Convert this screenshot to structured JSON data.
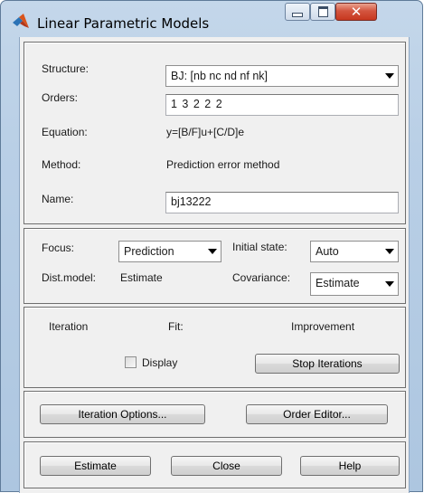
{
  "window": {
    "title": "Linear Parametric Models"
  },
  "model": {
    "structure_label": "Structure:",
    "structure_value": "BJ: [nb nc nd nf nk]",
    "orders_label": "Orders:",
    "orders_value": "1 3 2 2 2",
    "equation_label": "Equation:",
    "equation_value": "y=[B/F]u+[C/D]e",
    "method_label": "Method:",
    "method_value": "Prediction error method",
    "name_label": "Name:",
    "name_value": "bj13222"
  },
  "options": {
    "focus_label": "Focus:",
    "focus_value": "Prediction",
    "initial_state_label": "Initial state:",
    "initial_state_value": "Auto",
    "dist_model_label": "Dist.model:",
    "dist_model_value": "Estimate",
    "covariance_label": "Covariance:",
    "covariance_value": "Estimate"
  },
  "iteration": {
    "iteration_label": "Iteration",
    "fit_label": "Fit:",
    "improvement_label": "Improvement",
    "display_label": "Display",
    "display_checked": false,
    "stop_button": "Stop Iterations"
  },
  "editors": {
    "iteration_options_button": "Iteration Options...",
    "order_editor_button": "Order Editor..."
  },
  "actions": {
    "estimate_button": "Estimate",
    "close_button": "Close",
    "help_button": "Help"
  }
}
